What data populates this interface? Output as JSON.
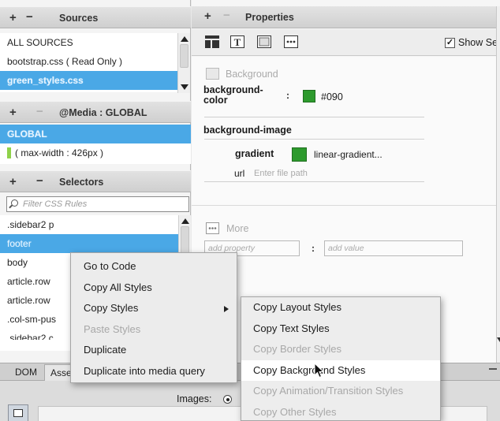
{
  "sources": {
    "header": "Sources",
    "plus": "+",
    "minus": "−",
    "items": [
      {
        "label": "ALL SOURCES"
      },
      {
        "label": "bootstrap.css  ( Read Only )"
      },
      {
        "label": "green_styles.css"
      }
    ]
  },
  "media": {
    "header": "@Media : GLOBAL",
    "plus": "+",
    "minus": "−",
    "items": [
      {
        "label": "GLOBAL"
      },
      {
        "label": "( max-width : 426px )"
      }
    ]
  },
  "selectors": {
    "header": "Selectors",
    "plus": "+",
    "minus": "−",
    "filter_placeholder": "Filter CSS Rules",
    "items": [
      {
        "label": ".sidebar2 p"
      },
      {
        "label": "footer"
      },
      {
        "label": "body"
      },
      {
        "label": "article.row"
      },
      {
        "label": "article.row"
      },
      {
        "label": ".col-sm-pus"
      },
      {
        "label": ".sidebar2 c"
      }
    ]
  },
  "properties": {
    "header": "Properties",
    "plus": "+",
    "minus": "−",
    "show_set_label": "Show Se",
    "show_set_checked": true,
    "background_heading": "Background",
    "bg_color_label": "background-\ncolor",
    "bg_color_colon": ":",
    "bg_color_value": "#090",
    "bg_color_hex": "#2d9a2d",
    "bg_image_label": "background-image",
    "gradient_label": "gradient",
    "gradient_value": "linear-gradient...",
    "url_label": "url",
    "url_placeholder": "Enter file path",
    "more_heading": "More",
    "add_property_placeholder": "add property",
    "add_value_colon": ":",
    "add_value_placeholder": "add value"
  },
  "bottom": {
    "tabs": [
      {
        "label": "DOM"
      },
      {
        "label": "Assets"
      }
    ],
    "images_label": "Images:"
  },
  "context_menu": {
    "items": [
      {
        "label": "Go to Code",
        "enabled": true
      },
      {
        "label": "Copy All Styles",
        "enabled": true
      },
      {
        "label": "Copy Styles",
        "enabled": true,
        "submenu": true
      },
      {
        "label": "Paste Styles",
        "enabled": false
      },
      {
        "label": "Duplicate",
        "enabled": true
      },
      {
        "label": "Duplicate into media query",
        "enabled": true
      }
    ]
  },
  "submenu": {
    "items": [
      {
        "label": "Copy Layout Styles",
        "enabled": true
      },
      {
        "label": "Copy Text Styles",
        "enabled": true
      },
      {
        "label": "Copy Border Styles",
        "enabled": false
      },
      {
        "label": "Copy Background Styles",
        "enabled": true,
        "highlighted": true
      },
      {
        "label": "Copy Animation/Transition Styles",
        "enabled": false
      },
      {
        "label": "Copy Other Styles",
        "enabled": false
      }
    ]
  },
  "colors": {
    "selection": "#4aa8e6",
    "swatch_green": "#2d9a2d",
    "media_marker": "#8fd24a"
  }
}
